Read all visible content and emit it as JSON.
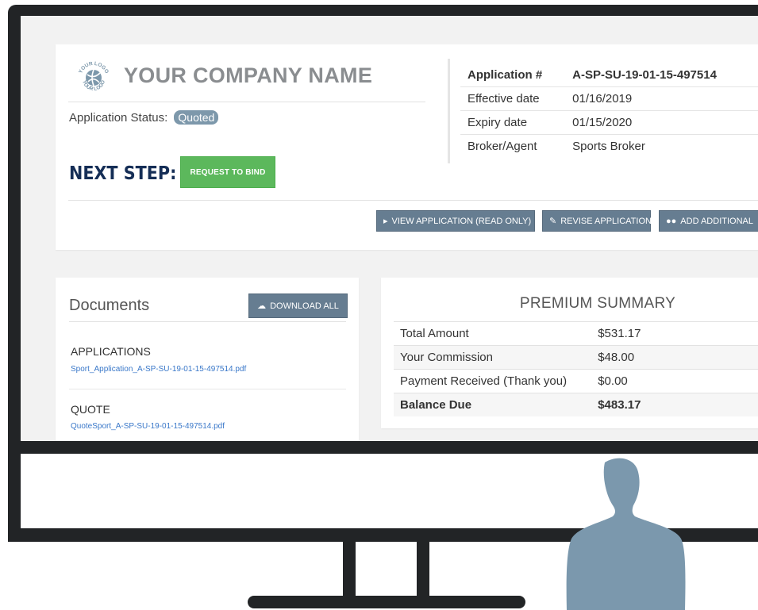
{
  "company": {
    "name": "YOUR COMPANY NAME",
    "logo_text": "YOUR LOGO"
  },
  "status": {
    "label": "Application Status:",
    "value": "Quoted"
  },
  "next_step": {
    "label": "NEXT STEP:",
    "button": "REQUEST TO BIND"
  },
  "application_info": [
    {
      "key": "Application #",
      "value": "A-SP-SU-19-01-15-497514"
    },
    {
      "key": "Effective date",
      "value": "01/16/2019"
    },
    {
      "key": "Expiry date",
      "value": "01/15/2020"
    },
    {
      "key": "Broker/Agent",
      "value": "Sports Broker"
    }
  ],
  "actions": {
    "view": "VIEW APPLICATION (READ ONLY)",
    "revise": "REVISE APPLICATION",
    "add": "ADD ADDITIONAL"
  },
  "documents": {
    "title": "Documents",
    "download_all": "DOWNLOAD ALL",
    "sections": [
      {
        "label": "APPLICATIONS",
        "file": "Sport_Application_A-SP-SU-19-01-15-497514.pdf"
      },
      {
        "label": "QUOTE",
        "file": "QuoteSport_A-SP-SU-19-01-15-497514.pdf"
      }
    ]
  },
  "premium": {
    "title": "PREMIUM SUMMARY",
    "rows": [
      {
        "key": "Total Amount",
        "value": "$531.17"
      },
      {
        "key": "Your Commission",
        "value": "$48.00"
      },
      {
        "key": "Payment Received (Thank you)",
        "value": "$0.00"
      },
      {
        "key": "Balance Due",
        "value": "$483.17"
      }
    ]
  },
  "colors": {
    "bezel": "#222426",
    "navy": "#152e56",
    "green": "#5cb85c",
    "slate_button": "#667d91",
    "badge": "#7d98ab",
    "silhouette": "#7b98ad",
    "link": "#3a78c9"
  }
}
